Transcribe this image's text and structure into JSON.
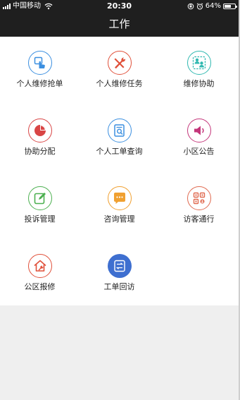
{
  "status": {
    "carrier": "中国移动",
    "time": "20:30",
    "battery_percent": "64%",
    "battery_level": 0.64
  },
  "header": {
    "title": "工作"
  },
  "grid": {
    "items": [
      {
        "label": "个人维修抢单",
        "icon": "hand-tap-icon",
        "color": "#3b8fe0"
      },
      {
        "label": "个人维修任务",
        "icon": "tools-icon",
        "color": "#e0503a"
      },
      {
        "label": "维修协助",
        "icon": "people-assist-icon",
        "color": "#2fb8b0"
      },
      {
        "label": "协助分配",
        "icon": "pie-chart-icon",
        "color": "#d94545"
      },
      {
        "label": "个人工单查询",
        "icon": "document-search-icon",
        "color": "#3b8fe0"
      },
      {
        "label": "小区公告",
        "icon": "speaker-icon",
        "color": "#c4367a"
      },
      {
        "label": "投诉管理",
        "icon": "edit-note-icon",
        "color": "#4cb050"
      },
      {
        "label": "咨询管理",
        "icon": "chat-bubble-icon",
        "color": "#f0a030"
      },
      {
        "label": "访客通行",
        "icon": "qr-code-icon",
        "color": "#e06a50"
      },
      {
        "label": "公区报修",
        "icon": "home-wrench-icon",
        "color": "#e0503a"
      },
      {
        "label": "工单回访",
        "icon": "return-visit-icon",
        "color": "#3e6fd0"
      }
    ]
  }
}
